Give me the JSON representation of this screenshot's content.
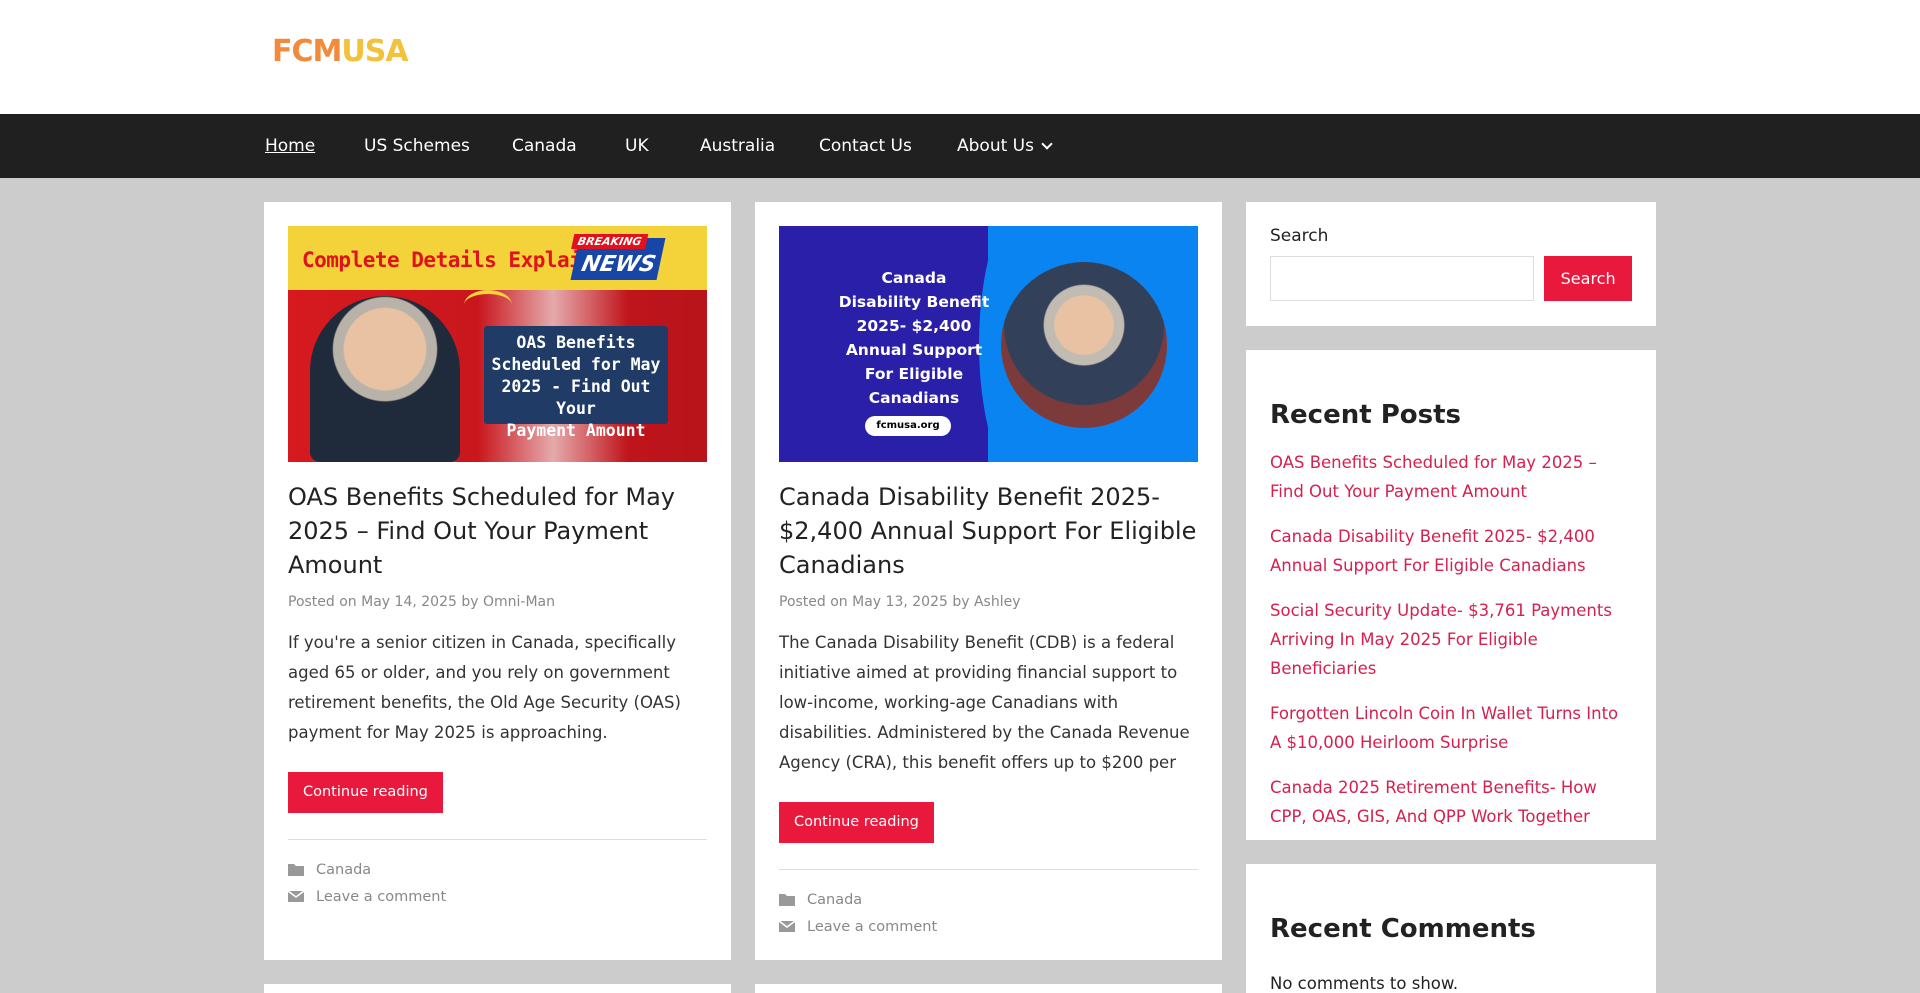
{
  "logo": {
    "part1": "FCM",
    "part2": "USA"
  },
  "nav": {
    "items": [
      {
        "label": "Home",
        "active": true
      },
      {
        "label": "US Schemes"
      },
      {
        "label": "Canada"
      },
      {
        "label": "UK"
      },
      {
        "label": "Australia"
      },
      {
        "label": "Contact Us"
      },
      {
        "label": "About Us",
        "has_dropdown": true
      }
    ]
  },
  "posts": [
    {
      "thumb": {
        "banner": "Complete Details Explained",
        "breaking": "BREAKING",
        "news": "NEWS",
        "box_lines": [
          "OAS Benefits",
          "Scheduled for May",
          "2025 - Find Out Your",
          "Payment Amount"
        ]
      },
      "title": "OAS Benefits Scheduled for May 2025 – Find Out Your Payment Amount",
      "posted_on": "Posted on",
      "date": "May 14, 2025",
      "by": "by",
      "author": "Omni-Man",
      "excerpt": "If you're a senior citizen in Canada, specifically aged 65 or older, and you rely on government retirement benefits, the Old Age Security (OAS) payment for May 2025 is approaching.",
      "button": "Continue reading",
      "category": "Canada",
      "comment": "Leave a comment"
    },
    {
      "thumb": {
        "lines": [
          "Canada",
          "Disability Benefit",
          "2025- $2,400",
          "Annual Support",
          "For Eligible",
          "Canadians"
        ],
        "pill": "fcmusa.org"
      },
      "title": "Canada Disability Benefit 2025- $2,400 Annual Support For Eligible Canadians",
      "posted_on": "Posted on",
      "date": "May 13, 2025",
      "by": "by",
      "author": "Ashley",
      "excerpt": "The Canada Disability Benefit (CDB) is a federal initiative aimed at providing financial support to low-income, working-age Canadians with disabilities. Administered by the Canada Revenue Agency (CRA), this benefit offers up to $200 per",
      "button": "Continue reading",
      "category": "Canada",
      "comment": "Leave a comment"
    }
  ],
  "sidebar": {
    "search_label": "Search",
    "search_button": "Search",
    "recent_posts_title": "Recent Posts",
    "recent_posts": [
      "OAS Benefits Scheduled for May 2025 – Find Out Your Payment Amount",
      "Canada Disability Benefit 2025- $2,400 Annual Support For Eligible Canadians",
      "Social Security Update- $3,761 Payments Arriving In May 2025 For Eligible Beneficiaries",
      "Forgotten Lincoln Coin In Wallet Turns Into A $10,000 Heirloom Surprise",
      "Canada 2025 Retirement Benefits- How CPP, OAS, GIS, And QPP Work Together"
    ],
    "recent_comments_title": "Recent Comments",
    "no_comments": "No comments to show."
  },
  "colors": {
    "accent": "#e8193c",
    "nav_bg": "#202020",
    "link": "#d6204f",
    "page_bg": "#cccccc"
  }
}
